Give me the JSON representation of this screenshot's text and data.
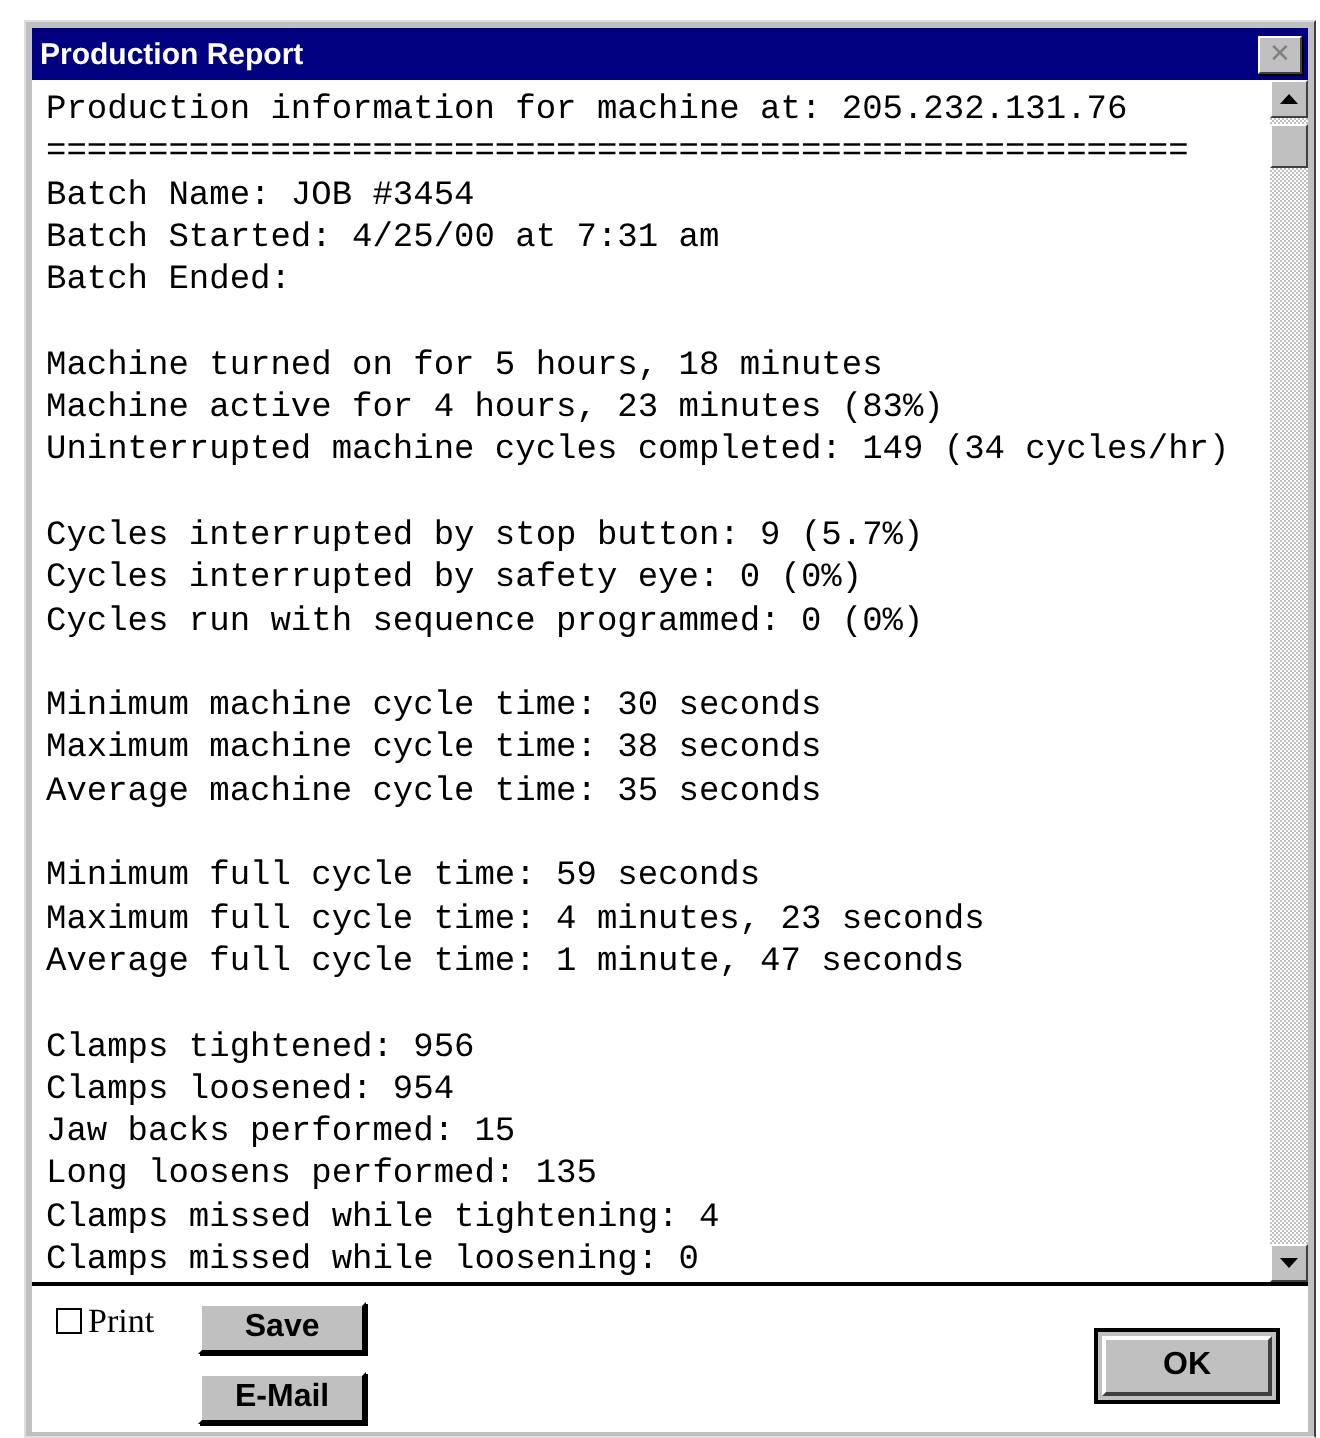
{
  "window": {
    "title": "Production Report",
    "close": "✕"
  },
  "report": {
    "groups": [
      [
        "Production information for machine at: 205.232.131.76",
        "========================================================",
        "Batch Name: JOB #3454",
        "Batch Started: 4/25/00 at 7:31 am",
        "Batch Ended:"
      ],
      [
        "Machine turned on for 5 hours, 18 minutes",
        "Machine active for 4 hours, 23 minutes (83%)",
        "Uninterrupted machine cycles completed: 149 (34 cycles/hr)"
      ],
      [
        "Cycles interrupted by stop button: 9 (5.7%)",
        "Cycles interrupted by safety eye: 0 (0%)",
        "Cycles run with sequence programmed: 0 (0%)"
      ],
      [
        "Minimum machine cycle time: 30 seconds",
        "Maximum machine cycle time: 38 seconds",
        "Average machine cycle time: 35 seconds"
      ],
      [
        "Minimum full cycle time: 59 seconds",
        "Maximum full cycle time: 4 minutes, 23 seconds",
        "Average full cycle time: 1 minute, 47 seconds"
      ],
      [
        "Clamps tightened: 956",
        "Clamps loosened: 954",
        "Jaw backs performed: 15",
        "Long loosens performed: 135",
        "Clamps missed while tightening: 4",
        "Clamps missed while loosening: 0"
      ]
    ]
  },
  "print": {
    "label": "Print",
    "checked": false
  },
  "buttons": [
    {
      "label": "Save",
      "kind": "side"
    },
    {
      "label": "E-Mail",
      "kind": "side"
    },
    {
      "label": "OK",
      "kind": "default"
    }
  ]
}
